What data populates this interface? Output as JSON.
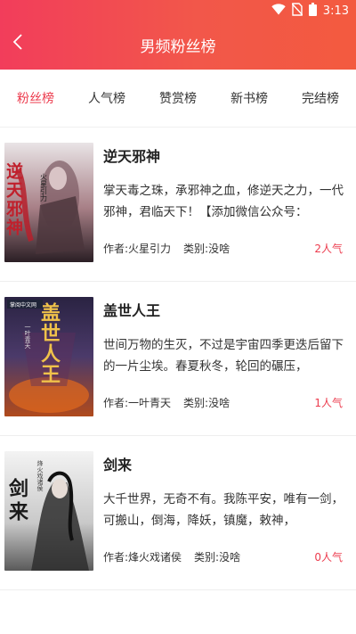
{
  "status_bar": {
    "time": "3:13",
    "icons": [
      "wifi-icon",
      "no-sim-icon",
      "battery-icon"
    ]
  },
  "header": {
    "title": "男频粉丝榜",
    "back_icon": "chevron-left-icon"
  },
  "tabs": [
    {
      "label": "粉丝榜",
      "active": true
    },
    {
      "label": "人气榜",
      "active": false
    },
    {
      "label": "赞赏榜",
      "active": false
    },
    {
      "label": "新书榜",
      "active": false
    },
    {
      "label": "完结榜",
      "active": false
    }
  ],
  "books": [
    {
      "title": "逆天邪神",
      "description": "掌天毒之珠，承邪神之血，修逆天之力，一代邪神，君临天下！【添加微信公众号：",
      "author": "作者:火星引力",
      "category": "类别:没啥",
      "popularity": "2人气",
      "cover": {
        "title": "逆天邪神",
        "author": "火星引力"
      }
    },
    {
      "title": "盖世人王",
      "description": "世间万物的生灭，不过是宇宙四季更迭后留下的一片尘埃。春夏秋冬，轮回的碾压，",
      "author": "作者:一叶青天",
      "category": "类别:没啥",
      "popularity": "1人气",
      "cover": {
        "title": "盖世人王",
        "author": "一叶青天",
        "publisher": "掌阅中文网"
      }
    },
    {
      "title": "剑来",
      "description": "大千世界，无奇不有。我陈平安，唯有一剑，可搬山，倒海，降妖，镇魔，敕神，",
      "author": "作者:烽火戏诸侯",
      "category": "类别:没啥",
      "popularity": "0人气",
      "cover": {
        "title": "剑来",
        "author": "烽火戏诸侯"
      }
    }
  ],
  "colors": {
    "accent": "#ec3b4d",
    "header_start": "#f23d5b",
    "header_end": "#f35a3f"
  }
}
